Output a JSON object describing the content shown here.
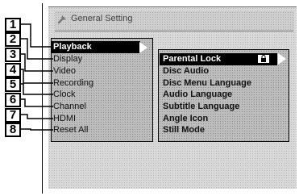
{
  "header": {
    "title": "General Setting",
    "icon": "wrench-icon"
  },
  "callouts": [
    "1",
    "2",
    "3",
    "4",
    "5",
    "6",
    "7",
    "8"
  ],
  "main_menu": {
    "items": [
      {
        "label": "Playback"
      },
      {
        "label": "Display"
      },
      {
        "label": "Video"
      },
      {
        "label": "Recording"
      },
      {
        "label": "Clock"
      },
      {
        "label": "Channel"
      },
      {
        "label": "HDMI"
      },
      {
        "label": "Reset All"
      }
    ],
    "selected": "Playback"
  },
  "sub_menu": {
    "items": [
      {
        "label": "Parental Lock"
      },
      {
        "label": "Disc Audio"
      },
      {
        "label": "Disc Menu Language"
      },
      {
        "label": "Audio Language"
      },
      {
        "label": "Subtitle Language"
      },
      {
        "label": "Angle Icon"
      },
      {
        "label": "Still Mode"
      }
    ],
    "selected": "Parental Lock",
    "selected_icon": "lock-icon"
  }
}
